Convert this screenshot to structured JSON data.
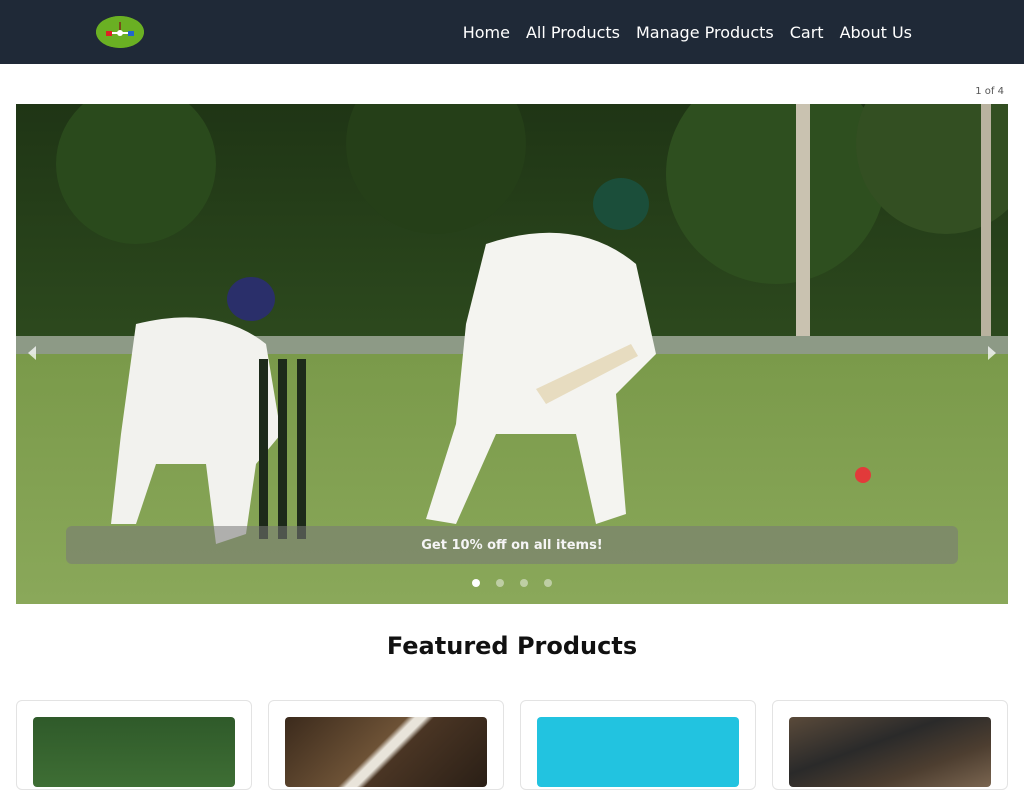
{
  "navbar": {
    "logo_icon": "cricket-logo-icon",
    "links": [
      "Home",
      "All Products",
      "Manage Products",
      "Cart",
      "About Us"
    ]
  },
  "carousel": {
    "counter": "1 of 4",
    "caption": "Get 10% off on all items!",
    "slide_count": 4,
    "active_index": 0,
    "prev_icon": "chevron-left-icon",
    "next_icon": "chevron-right-icon"
  },
  "featured": {
    "title": "Featured Products",
    "products": [
      {
        "image": "grass-field-image"
      },
      {
        "image": "cricket-bat-image"
      },
      {
        "image": "turquoise-product-image"
      },
      {
        "image": "player-action-image"
      }
    ]
  },
  "colors": {
    "navbar_bg": "#1f2937",
    "nav_text": "#ffffff",
    "caption_bg": "rgba(120,120,120,0.55)"
  }
}
